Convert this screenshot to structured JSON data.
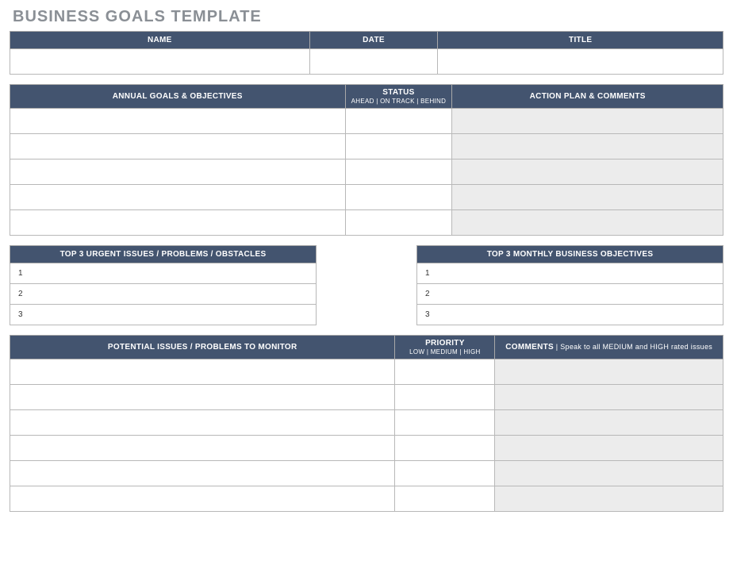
{
  "title": "BUSINESS GOALS TEMPLATE",
  "header": {
    "name_label": "NAME",
    "date_label": "DATE",
    "title_label": "TITLE",
    "name_value": "",
    "date_value": "",
    "title_value": ""
  },
  "goals": {
    "col_goals": "ANNUAL GOALS & OBJECTIVES",
    "col_status": "STATUS",
    "col_status_sub": "AHEAD | ON TRACK | BEHIND",
    "col_action": "ACTION PLAN & COMMENTS",
    "rows": [
      {
        "goal": "",
        "status": "",
        "action": ""
      },
      {
        "goal": "",
        "status": "",
        "action": ""
      },
      {
        "goal": "",
        "status": "",
        "action": ""
      },
      {
        "goal": "",
        "status": "",
        "action": ""
      },
      {
        "goal": "",
        "status": "",
        "action": ""
      }
    ]
  },
  "urgent": {
    "header": "TOP 3 URGENT ISSUES / PROBLEMS / OBSTACLES",
    "rows": [
      "1",
      "2",
      "3"
    ]
  },
  "monthly": {
    "header": "TOP 3 MONTHLY BUSINESS OBJECTIVES",
    "rows": [
      "1",
      "2",
      "3"
    ]
  },
  "potential": {
    "col_issues": "POTENTIAL ISSUES / PROBLEMS TO MONITOR",
    "col_priority": "PRIORITY",
    "col_priority_sub": "LOW | MEDIUM | HIGH",
    "col_comments_bold": "COMMENTS",
    "col_comments_rest": " | Speak to all MEDIUM and HIGH rated issues",
    "rows": [
      {
        "issue": "",
        "priority": "",
        "comment": ""
      },
      {
        "issue": "",
        "priority": "",
        "comment": ""
      },
      {
        "issue": "",
        "priority": "",
        "comment": ""
      },
      {
        "issue": "",
        "priority": "",
        "comment": ""
      },
      {
        "issue": "",
        "priority": "",
        "comment": ""
      },
      {
        "issue": "",
        "priority": "",
        "comment": ""
      }
    ]
  }
}
